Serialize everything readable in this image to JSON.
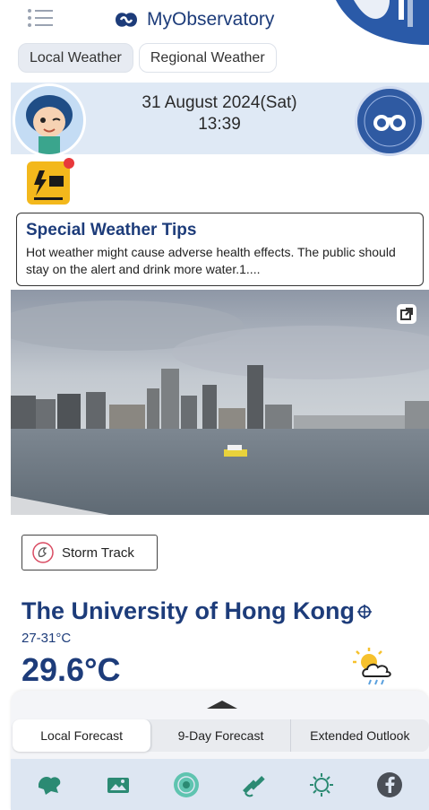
{
  "header": {
    "app_title": "MyObservatory",
    "menu_icon": "hamburger-menu-icon",
    "logo_icon": "observatory-logo-icon"
  },
  "top_tabs": [
    {
      "label": "Local Weather",
      "active": true
    },
    {
      "label": "Regional Weather",
      "active": false
    }
  ],
  "info": {
    "date": "31 August 2024(Sat)",
    "time": "13:39",
    "avatar_icon": "mascot-avatar-icon",
    "badge_icon": "my-weather-observer-icon",
    "warning_icon": "thunderstorm-warning-icon"
  },
  "tips": {
    "title": "Special Weather Tips",
    "text": "Hot weather might cause adverse health effects. The public should stay on the alert and drink more water.1...."
  },
  "photo": {
    "icon": "external-link-icon"
  },
  "storm": {
    "label": "Storm Track",
    "icon": "storm-track-icon"
  },
  "station": {
    "name": "The University of Hong Kong",
    "range": "27-31°C",
    "temperature": "29.6°C",
    "weather_icon": "sunny-intervals-showers-icon"
  },
  "forecast_tabs": [
    {
      "label": "Local Forecast",
      "active": true
    },
    {
      "label": "9-Day Forecast",
      "active": false
    },
    {
      "label": "Extended Outlook",
      "active": false
    }
  ],
  "bottom_nav": [
    {
      "icon": "weather-map-icon"
    },
    {
      "icon": "weather-photo-icon"
    },
    {
      "icon": "radar-icon"
    },
    {
      "icon": "satellite-icon"
    },
    {
      "icon": "uv-index-icon"
    },
    {
      "icon": "facebook-icon"
    }
  ],
  "colors": {
    "brand": "#1d3c7a",
    "band": "#dfe9f5",
    "warning": "#f3b81c"
  }
}
